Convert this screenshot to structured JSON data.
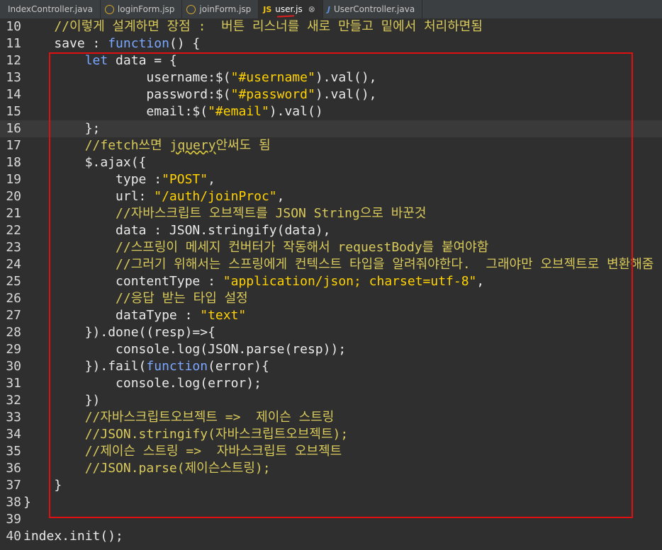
{
  "tabs": [
    {
      "label": "IndexController.java",
      "icon": "java-file-icon"
    },
    {
      "label": "loginForm.jsp",
      "icon": "jsp-globe-icon"
    },
    {
      "label": "joinForm.jsp",
      "icon": "jsp-globe-icon"
    },
    {
      "label": "user.js",
      "icon": "js-file-icon",
      "active": true,
      "close": "⊗"
    },
    {
      "label": "UserController.java",
      "icon": "java-file-icon"
    }
  ],
  "icons": {
    "js": "JS",
    "java": "J"
  },
  "lines": [
    {
      "n": "10",
      "t": [
        [
          "cm",
          "    //이렇게 설계하면 장점 :  버튼 리스너를 새로 만들고 밑에서 처리하면됨"
        ]
      ]
    },
    {
      "n": "11",
      "fold": true,
      "t": [
        [
          "",
          "    save : "
        ],
        [
          "kw",
          "function"
        ],
        [
          "",
          "() {"
        ]
      ]
    },
    {
      "n": "12",
      "fold": true,
      "t": [
        [
          "",
          "        "
        ],
        [
          "kw",
          "let"
        ],
        [
          "",
          " data = {"
        ]
      ]
    },
    {
      "n": "13",
      "t": [
        [
          "",
          "                username:$("
        ],
        [
          "str",
          "\"#username\""
        ],
        [
          "",
          ").val(),"
        ]
      ]
    },
    {
      "n": "14",
      "t": [
        [
          "",
          "                password:$("
        ],
        [
          "str",
          "\"#password\""
        ],
        [
          "",
          ").val(),"
        ]
      ]
    },
    {
      "n": "15",
      "t": [
        [
          "",
          "                email:$("
        ],
        [
          "str",
          "\"#email\""
        ],
        [
          "",
          ").val()"
        ]
      ]
    },
    {
      "n": "16",
      "cur": true,
      "t": [
        [
          "",
          "        };"
        ]
      ]
    },
    {
      "n": "17",
      "t": [
        [
          "cm",
          "        //fetch쓰면 "
        ],
        [
          "cm sq",
          "jquery"
        ],
        [
          "cm",
          "안써도 됨"
        ]
      ]
    },
    {
      "n": "18",
      "fold": true,
      "t": [
        [
          "",
          "        $.ajax({"
        ]
      ]
    },
    {
      "n": "19",
      "t": [
        [
          "",
          "            type :"
        ],
        [
          "str",
          "\"POST\""
        ],
        [
          "",
          ","
        ]
      ]
    },
    {
      "n": "20",
      "t": [
        [
          "",
          "            url: "
        ],
        [
          "str",
          "\"/auth/joinProc\""
        ],
        [
          "",
          ","
        ]
      ]
    },
    {
      "n": "21",
      "t": [
        [
          "cm",
          "            //자바스크립트 오브젝트를 JSON String으로 바꾼것"
        ]
      ]
    },
    {
      "n": "22",
      "t": [
        [
          "",
          "            data : JSON.stringify(data),"
        ]
      ]
    },
    {
      "n": "23",
      "t": [
        [
          "cm",
          "            //스프링이 메세지 컨버터가 작동해서 requestBody를 붙여야함"
        ]
      ]
    },
    {
      "n": "24",
      "t": [
        [
          "cm",
          "            //그러기 위해서는 스프링에게 컨텍스트 타입을 알려줘야한다.  그래야만 오브젝트로 변환해줌"
        ]
      ]
    },
    {
      "n": "25",
      "t": [
        [
          "",
          "            contentType : "
        ],
        [
          "str",
          "\"application/json; charset=utf-8\""
        ],
        [
          "",
          ","
        ]
      ]
    },
    {
      "n": "26",
      "t": [
        [
          "cm",
          "            //응답 받는 타입 설정"
        ]
      ]
    },
    {
      "n": "27",
      "t": [
        [
          "",
          "            dataType : "
        ],
        [
          "str",
          "\"text\""
        ]
      ]
    },
    {
      "n": "28",
      "t": [
        [
          "",
          "        }).done((resp)=>{"
        ]
      ]
    },
    {
      "n": "29",
      "t": [
        [
          "",
          "            console.log(JSON.parse(resp));"
        ]
      ]
    },
    {
      "n": "30",
      "t": [
        [
          "",
          "        }).fail("
        ],
        [
          "kw",
          "function"
        ],
        [
          "",
          "(error){"
        ]
      ]
    },
    {
      "n": "31",
      "t": [
        [
          "",
          "            console.log(error);"
        ]
      ]
    },
    {
      "n": "32",
      "t": [
        [
          "",
          "        })"
        ]
      ]
    },
    {
      "n": "33",
      "t": [
        [
          "cm",
          "        //자바스크립트오브젝트 =>  제이슨 스트링"
        ]
      ]
    },
    {
      "n": "34",
      "t": [
        [
          "cm",
          "        //JSON.stringify(자바스크립트오브젝트);"
        ]
      ]
    },
    {
      "n": "35",
      "t": [
        [
          "cm",
          "        //제이슨 스트링 =>  자바스크립트 오브젝트"
        ]
      ]
    },
    {
      "n": "36",
      "t": [
        [
          "cm",
          "        //JSON.parse(제이슨스트링);"
        ]
      ]
    },
    {
      "n": "37",
      "t": [
        [
          "",
          "    }"
        ]
      ]
    },
    {
      "n": "38",
      "t": [
        [
          "",
          "}"
        ]
      ]
    },
    {
      "n": "39",
      "t": [
        [
          "",
          ""
        ]
      ]
    },
    {
      "n": "40",
      "t": [
        [
          "",
          "index.init();"
        ]
      ]
    }
  ],
  "colors": {
    "highlight_box": "#e01010",
    "keyword": "#7aa7ff",
    "string": "#ffd200",
    "comment": "#d8c95a"
  }
}
